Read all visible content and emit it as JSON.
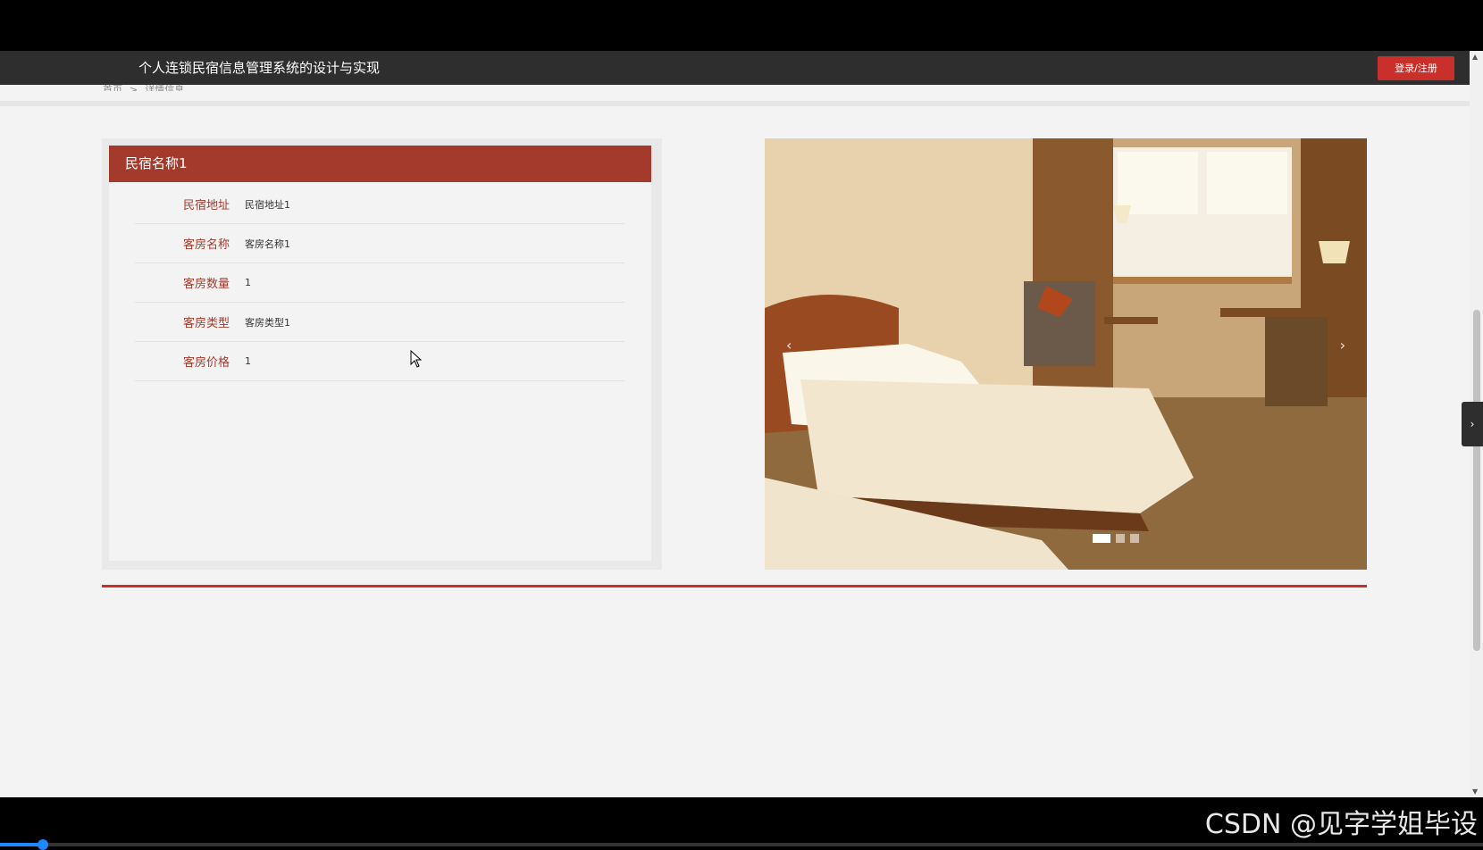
{
  "nav": {
    "title": "个人连锁民宿信息管理系统的设计与实现",
    "login_label": "登录/注册"
  },
  "breadcrumb": {
    "home": "首页",
    "separator": ">",
    "current": "详情信息"
  },
  "detail": {
    "name": "民宿名称1",
    "rows": [
      {
        "label": "民宿地址",
        "value": "民宿地址1"
      },
      {
        "label": "客房名称",
        "value": "客房名称1"
      },
      {
        "label": "客房数量",
        "value": "1"
      },
      {
        "label": "客房类型",
        "value": "客房类型1"
      },
      {
        "label": "客房价格",
        "value": "1"
      }
    ]
  },
  "carousel": {
    "prev_icon": "‹",
    "next_icon": "›",
    "slide_count": 3,
    "active_index": 0
  },
  "side_toggle_icon": "›",
  "watermark": "CSDN @见字学姐毕设",
  "video_progress": 0.03,
  "colors": {
    "accent": "#a43a2c",
    "button": "#c9302c",
    "nav": "#2e2e2e"
  }
}
